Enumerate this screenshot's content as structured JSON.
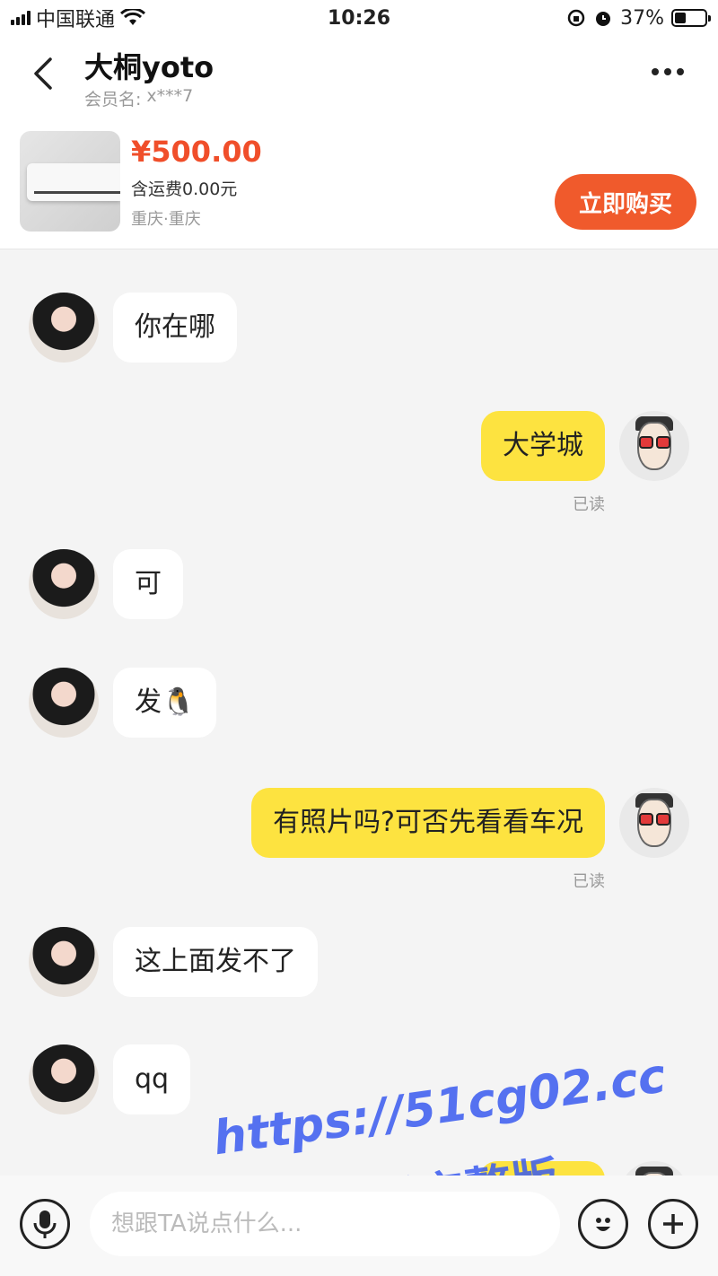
{
  "status_bar": {
    "carrier": "中国联通",
    "time": "10:26",
    "battery": "37%",
    "battery_level": 0.37
  },
  "header": {
    "title": "大桐yoto",
    "member_label": "会员名:",
    "member_value": "x***7"
  },
  "product": {
    "price": "¥500.00",
    "shipping": "含运费0.00元",
    "location": "重庆·重庆",
    "buy_label": "立即购买"
  },
  "messages": [
    {
      "side": "in",
      "text": "你在哪"
    },
    {
      "side": "out",
      "text": "大学城",
      "status": "已读"
    },
    {
      "side": "in",
      "text": "可"
    },
    {
      "side": "in",
      "text": "发🐧"
    },
    {
      "side": "out",
      "text": "有照片吗?可否先看看车况",
      "status": "已读"
    },
    {
      "side": "in",
      "text": "这上面发不了"
    },
    {
      "side": "in",
      "text": "qq"
    }
  ],
  "watermark": {
    "line1": "https://51cg02.cc",
    "line2": "看完整版"
  },
  "input_bar": {
    "placeholder": "想跟TA说点什么..."
  }
}
